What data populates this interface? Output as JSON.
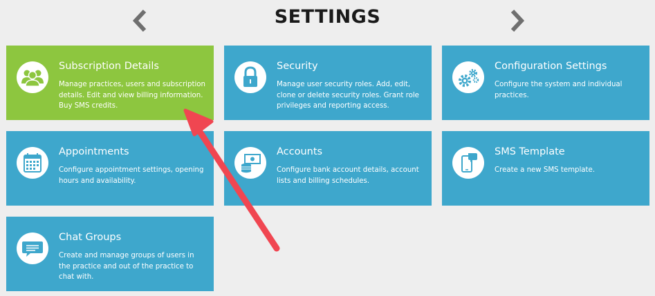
{
  "header": {
    "title": "SETTINGS",
    "prev_icon": "chevron-left-icon",
    "next_icon": "chevron-right-icon"
  },
  "colors": {
    "tile": "#3ea7cc",
    "tile_active": "#8dc63f",
    "annotation_arrow": "#f04651",
    "background": "#eeeeee"
  },
  "tiles": [
    {
      "title": "Subscription Details",
      "desc": "Manage practices, users and subscription details. Edit and view billing information. Buy SMS credits.",
      "icon": "users-icon",
      "active": true
    },
    {
      "title": "Security",
      "desc": "Manage user security roles. Add, edit, clone or delete security roles. Grant role privileges and reporting access.",
      "icon": "lock-icon"
    },
    {
      "title": "Configuration Settings",
      "desc": "Configure the system and individual practices.",
      "icon": "gears-icon"
    },
    {
      "title": "Appointments",
      "desc": "Configure appointment settings, opening hours and availability.",
      "icon": "calendar-icon"
    },
    {
      "title": "Accounts",
      "desc": "Configure bank account details, account lists and billing schedules.",
      "icon": "money-icon"
    },
    {
      "title": "SMS Template",
      "desc": "Create a new SMS template.",
      "icon": "mobile-phone-icon"
    },
    {
      "title": "Chat Groups",
      "desc": "Create and manage groups of users in the practice and out of the practice to chat with.",
      "icon": "chat-bubble-icon"
    }
  ]
}
